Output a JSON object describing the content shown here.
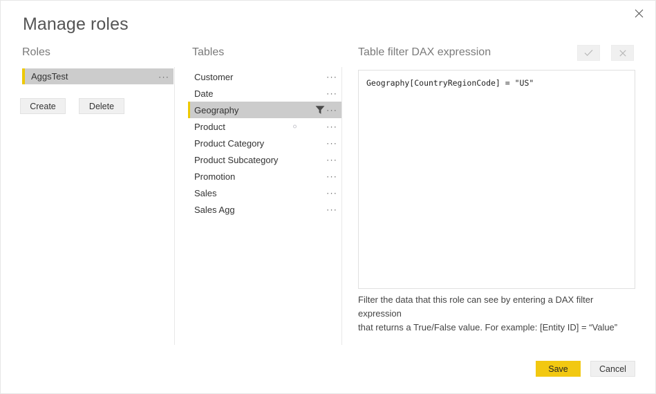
{
  "dialog": {
    "title": "Manage roles",
    "close_label": "×"
  },
  "roles": {
    "heading": "Roles",
    "items": [
      {
        "name": "AggsTest",
        "selected": true,
        "ellipsis": "···"
      }
    ],
    "create_label": "Create",
    "delete_label": "Delete"
  },
  "tables": {
    "heading": "Tables",
    "ellipsis": "···",
    "items": [
      {
        "name": "Customer",
        "selected": false,
        "has_filter": false
      },
      {
        "name": "Date",
        "selected": false,
        "has_filter": false
      },
      {
        "name": "Geography",
        "selected": true,
        "has_filter": true
      },
      {
        "name": "Product",
        "selected": false,
        "has_filter": false
      },
      {
        "name": "Product Category",
        "selected": false,
        "has_filter": false
      },
      {
        "name": "Product Subcategory",
        "selected": false,
        "has_filter": false
      },
      {
        "name": "Promotion",
        "selected": false,
        "has_filter": false
      },
      {
        "name": "Sales",
        "selected": false,
        "has_filter": false
      },
      {
        "name": "Sales Agg",
        "selected": false,
        "has_filter": false
      }
    ]
  },
  "dax": {
    "heading": "Table filter DAX expression",
    "expression": "Geography[CountryRegionCode] = \"US\"",
    "placeholder": "",
    "help_line1": "Filter the data that this role can see by entering a DAX filter expression",
    "help_line2": "that returns a True/False value. For example: [Entity ID] = “Value”"
  },
  "footer": {
    "save_label": "Save",
    "cancel_label": "Cancel"
  },
  "colors": {
    "accent_yellow": "#eec900",
    "brand_yellow": "#f2c811",
    "selection_gray": "#cccccc",
    "button_gray": "#f0f0f0"
  }
}
